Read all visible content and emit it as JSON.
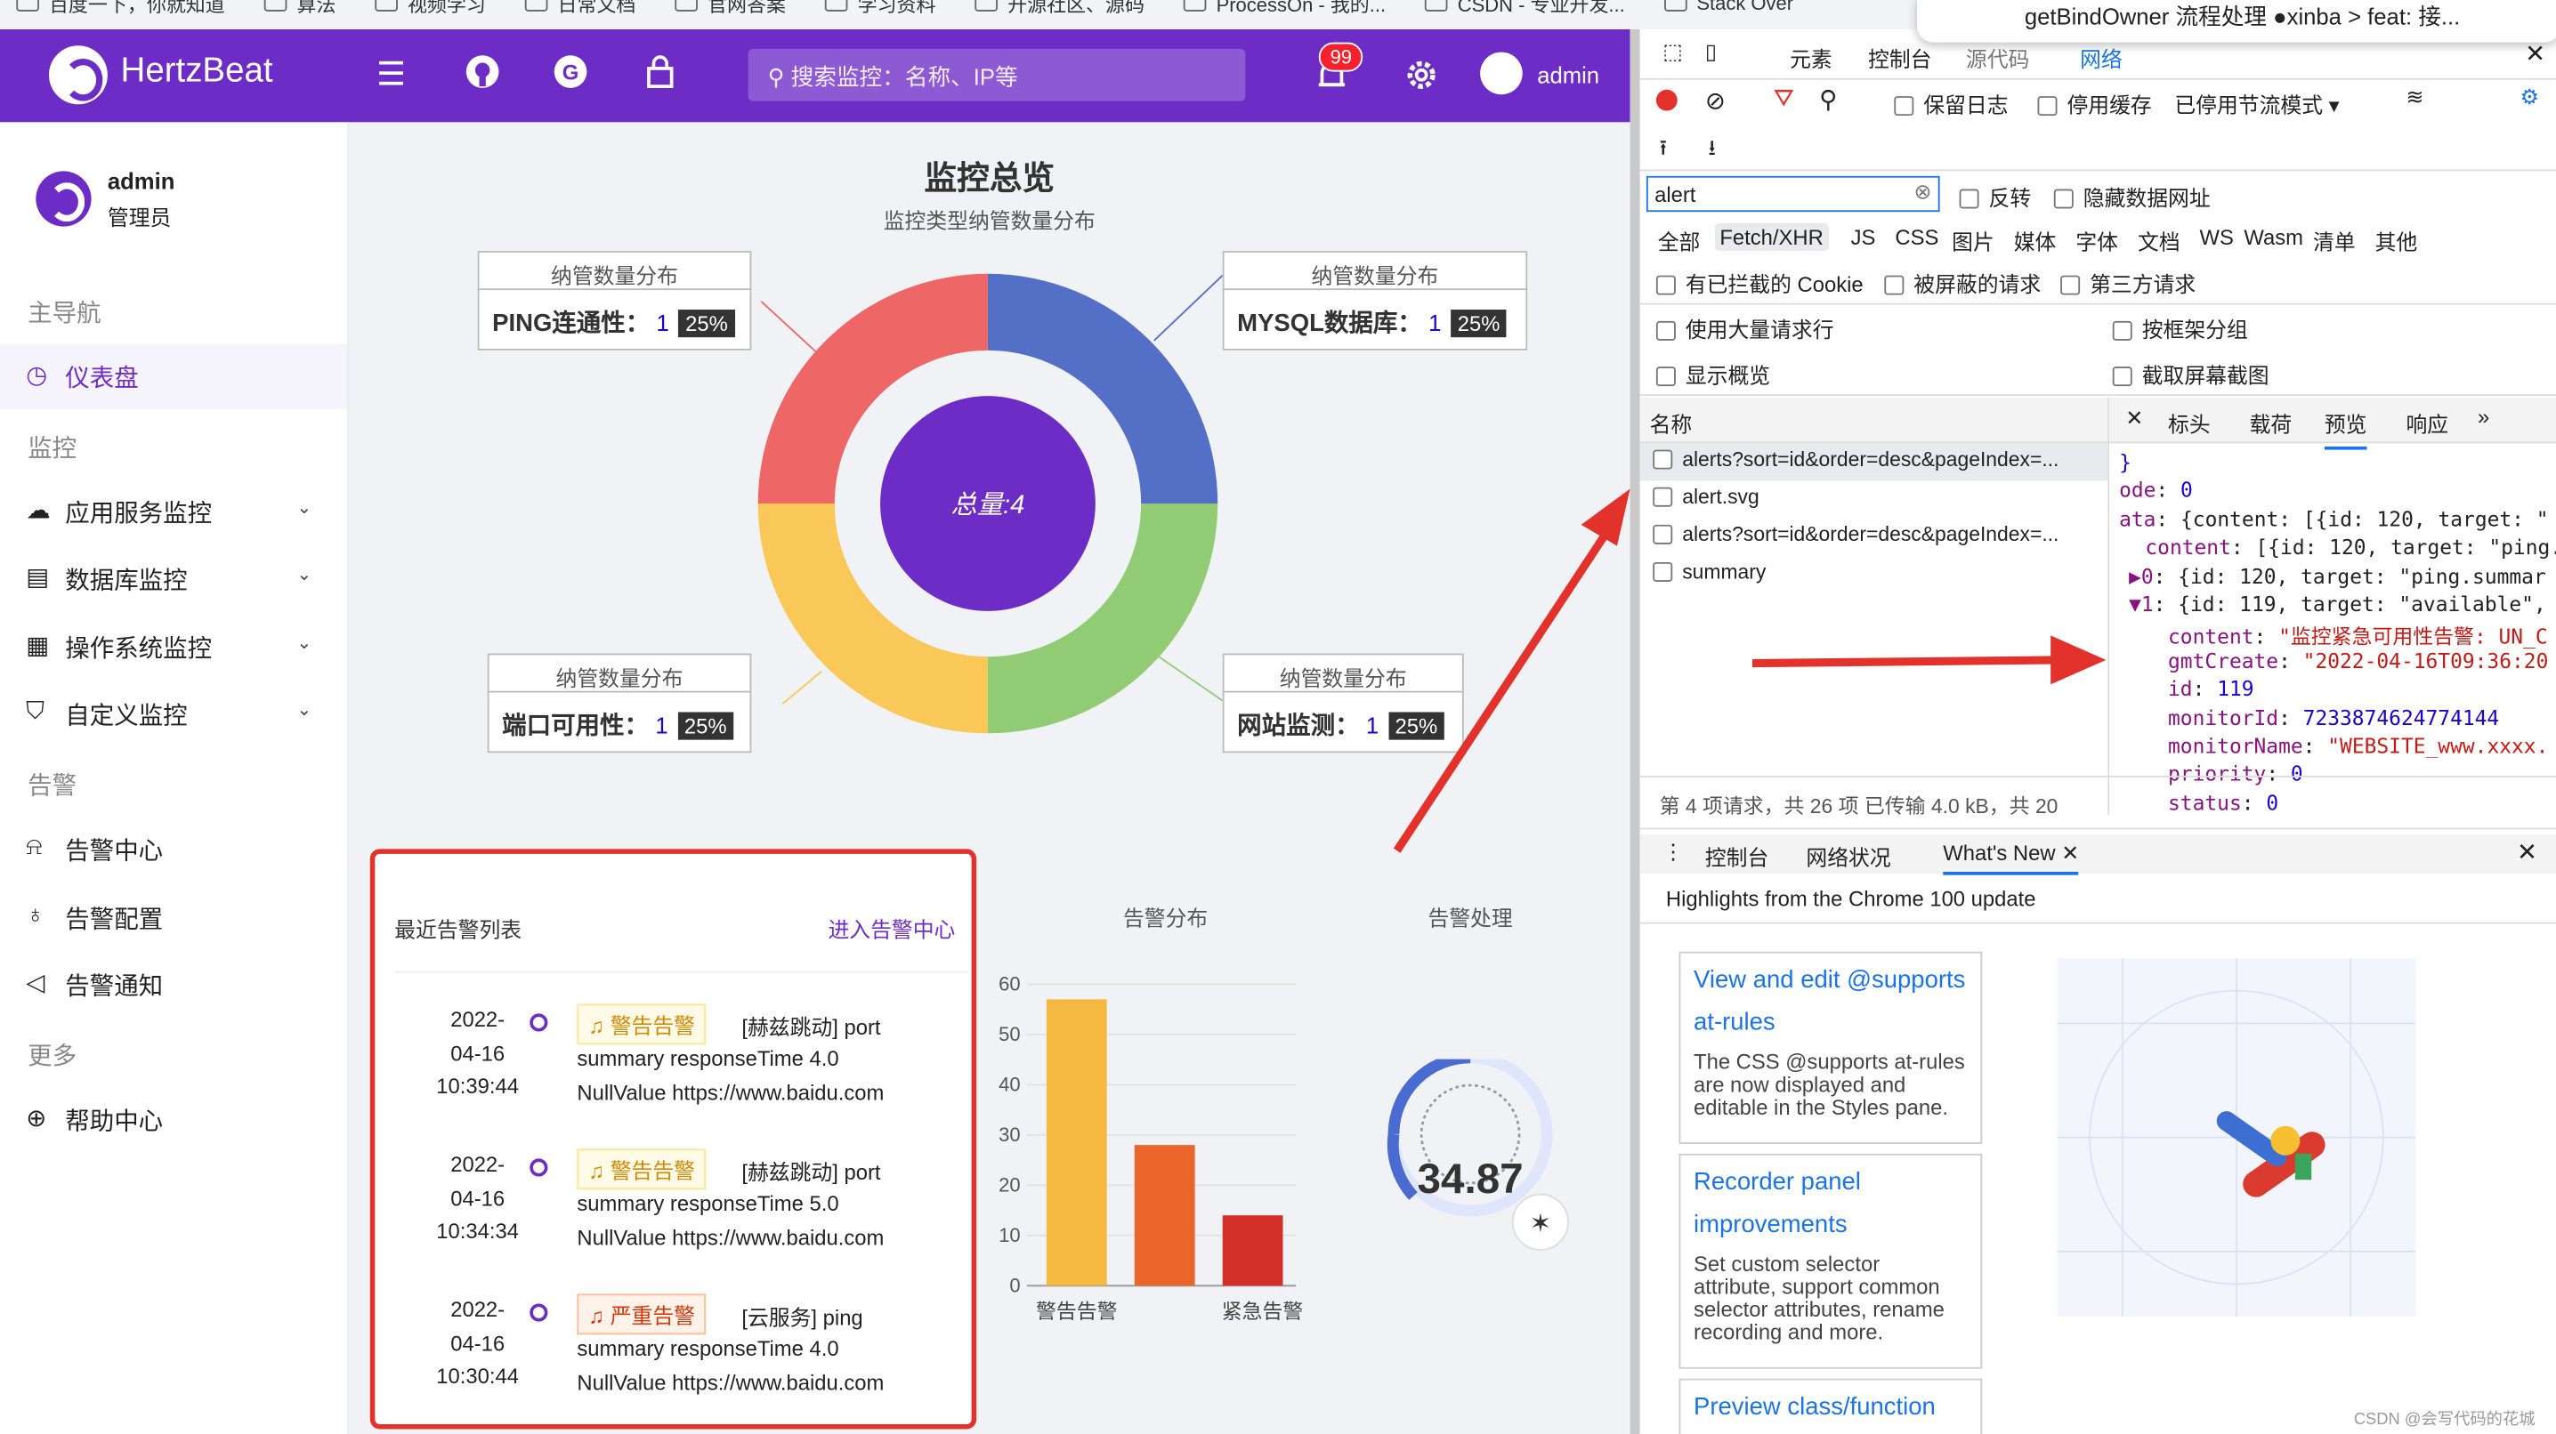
{
  "bookmarks": [
    "百度一下，你就知道",
    "算法",
    "视频学习",
    "日常文档",
    "官网答案",
    "学习资料",
    "开源社区、源码",
    "ProcessOn - 我的...",
    "CSDN - 专业开发...",
    "Stack Over"
  ],
  "tooltip": "getBindOwner 流程处理 ●xinba > feat: 接...",
  "app": {
    "brand": "HertzBeat",
    "search_placeholder": "搜索监控：名称、IP等",
    "notification_count": "99",
    "user": "admin",
    "icons": [
      "menu-icon",
      "github-icon",
      "gitee-icon",
      "lock-icon",
      "bell-icon",
      "gear-icon"
    ]
  },
  "sidebar": {
    "user_name": "admin",
    "user_role": "管理员",
    "groups": {
      "main": "主导航",
      "monitor": "监控",
      "alert": "告警",
      "more": "更多"
    },
    "items": [
      {
        "label": "仪表盘",
        "icon": "◷"
      },
      {
        "label": "应用服务监控",
        "icon": "☁"
      },
      {
        "label": "数据库监控",
        "icon": "▤"
      },
      {
        "label": "操作系统监控",
        "icon": "▦"
      },
      {
        "label": "自定义监控",
        "icon": "⛉"
      },
      {
        "label": "告警中心",
        "icon": "⍾"
      },
      {
        "label": "告警配置",
        "icon": "♁"
      },
      {
        "label": "告警通知",
        "icon": "◁"
      },
      {
        "label": "帮助中心",
        "icon": "⊕"
      }
    ],
    "colors": {
      "accent": "#6e2cc7"
    }
  },
  "overview": {
    "title": "监控总览",
    "subtitle": "监控类型纳管数量分布",
    "center_label": "总量:4",
    "boxes": [
      {
        "title": "纳管数量分布",
        "name": "PING连通性：",
        "count": "1",
        "pct": "25%"
      },
      {
        "title": "纳管数量分布",
        "name": "MYSQL数据库：",
        "count": "1",
        "pct": "25%"
      },
      {
        "title": "纳管数量分布",
        "name": "端口可用性：",
        "count": "1",
        "pct": "25%"
      },
      {
        "title": "纳管数量分布",
        "name": "网站监测：",
        "count": "1",
        "pct": "25%"
      }
    ]
  },
  "chart_data": [
    {
      "type": "pie",
      "center_label": "总量:4",
      "categories": [
        "MYSQL数据库",
        "网站监测",
        "端口可用性",
        "PING连通性"
      ],
      "values": [
        1,
        1,
        1,
        1
      ],
      "colors": [
        "#5470c6",
        "#91cc75",
        "#fac858",
        "#ee6666"
      ]
    },
    {
      "type": "bar",
      "title": "告警分布",
      "categories": [
        "警告告警",
        "",
        "紧急告警"
      ],
      "values": [
        57,
        28,
        14
      ],
      "colors": [
        "#f5b942",
        "#e9652a",
        "#d42f26"
      ],
      "yticks": [
        "0",
        "10",
        "20",
        "30",
        "40",
        "50",
        "60"
      ],
      "ylim": [
        0,
        60
      ]
    },
    {
      "type": "gauge",
      "title": "告警处理",
      "value": "34.87"
    }
  ],
  "alerts": {
    "title": "最近告警列表",
    "link": "进入告警中心",
    "items": [
      {
        "date": "2022-",
        "date2": "04-16",
        "time": "10:39:44",
        "tag": "警告告警",
        "source": "[赫兹跳动] port",
        "line2": "summary responseTime 4.0",
        "line3": "NullValue https://www.baidu.com"
      },
      {
        "date": "2022-",
        "date2": "04-16",
        "time": "10:34:34",
        "tag": "警告告警",
        "source": "[赫兹跳动] port",
        "line2": "summary responseTime 5.0",
        "line3": "NullValue https://www.baidu.com"
      },
      {
        "date": "2022-",
        "date2": "04-16",
        "time": "10:30:44",
        "tag": "严重告警",
        "source": "[云服务] ping",
        "line2": "summary responseTime 4.0",
        "line3": "NullValue https://www.baidu.com"
      }
    ]
  },
  "devtools": {
    "top_tabs": [
      "元素",
      "控制台",
      "源代码",
      "网络"
    ],
    "toolbar": {
      "preserve_log": "保留日志",
      "disable_cache": "停用缓存",
      "throttle": "已停用节流模式"
    },
    "filter_value": "alert",
    "invert": "反转",
    "hide_data_urls": "隐藏数据网址",
    "type_filters": [
      "全部",
      "Fetch/XHR",
      "JS",
      "CSS",
      "图片",
      "媒体",
      "字体",
      "文档",
      "WS",
      "Wasm",
      "清单",
      "其他"
    ],
    "blocked_cookies": "有已拦截的 Cookie",
    "blocked_requests": "被屏蔽的请求",
    "third_party": "第三方请求",
    "big_rows": "使用大量请求行",
    "group_by_frame": "按框架分组",
    "overview": "显示概览",
    "screenshots": "截取屏幕截图",
    "name_col": "名称",
    "detail_tabs": [
      "标头",
      "载荷",
      "预览",
      "响应"
    ],
    "requests": [
      "alerts?sort=id&order=desc&pageIndex=...",
      "alert.svg",
      "alerts?sort=id&order=desc&pageIndex=...",
      "summary"
    ],
    "status_bar": "第 4 项请求，共 26 项   已传输 4.0 kB，共 20",
    "json_lines": [
      {
        "k": "",
        "v": "}"
      },
      {
        "k": "ode",
        "v": " 0"
      },
      {
        "k": "ata",
        "v": " {content: [{id: 120, target: \""
      },
      {
        "k": "content",
        "v": " [{id: 120, target: \"ping.s"
      },
      {
        "k": "▶0",
        "v": " {id: 120, target: \"ping.summar"
      },
      {
        "k": "▼1",
        "v": " {id: 119, target: \"available\","
      },
      {
        "k": "content",
        "v": " \"监控紧急可用性告警: UN_C"
      },
      {
        "k": "gmtCreate",
        "v": " \"2022-04-16T09:36:20"
      },
      {
        "k": "id",
        "v": " 119"
      },
      {
        "k": "monitorId",
        "v": " 7233874624774144"
      },
      {
        "k": "monitorName",
        "v": " \"WEBSITE_www.xxxx."
      },
      {
        "k": "priority",
        "v": " 0"
      },
      {
        "k": "status",
        "v": " 0"
      }
    ],
    "drawer_tabs": [
      "控制台",
      "网络状况",
      "What's New"
    ],
    "drawer_heading": "Highlights from the Chrome 100 update",
    "news": [
      {
        "title": "View and edit @supports at-rules",
        "desc": "The CSS @supports at-rules are now displayed and editable in the Styles pane."
      },
      {
        "title": "Recorder panel improvements",
        "desc": "Set custom selector attribute, support common selector attributes, rename recording and more."
      },
      {
        "title": "Preview class/function",
        "desc": ""
      }
    ]
  },
  "watermark": "CSDN @会写代码的花城"
}
